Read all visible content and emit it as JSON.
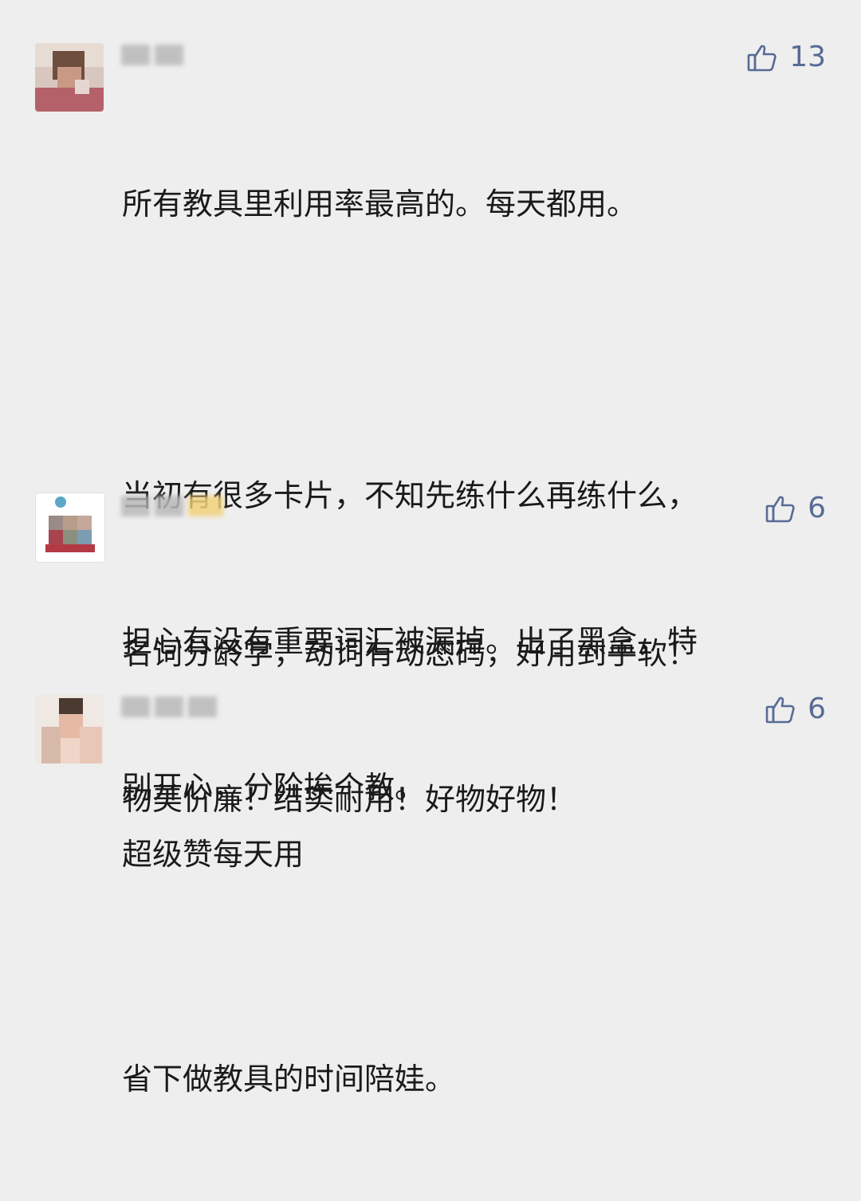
{
  "comments": [
    {
      "likes": "13",
      "paragraphs": [
        "所有教具里利用率最高的。每天都用。",
        "",
        "当初有很多卡片，不知先练什么再练什么，",
        "担心有没有重要词汇被漏掉。出了黑盒，特",
        "别开心，分阶挨个教。",
        "",
        "省下做教具的时间陪娃。"
      ]
    },
    {
      "likes": "6",
      "paragraphs": [
        "名词分龄学，动词有动态码，好用到手软！",
        "物美价廉！结实耐用！好物好物！"
      ]
    },
    {
      "likes": "6",
      "paragraphs": [
        "超级赞每天用"
      ]
    }
  ],
  "icons": {
    "like": "thumbs-up-icon"
  },
  "colors": {
    "accent": "#576b95",
    "text": "#1a1a1a",
    "background": "#eeeeee"
  }
}
